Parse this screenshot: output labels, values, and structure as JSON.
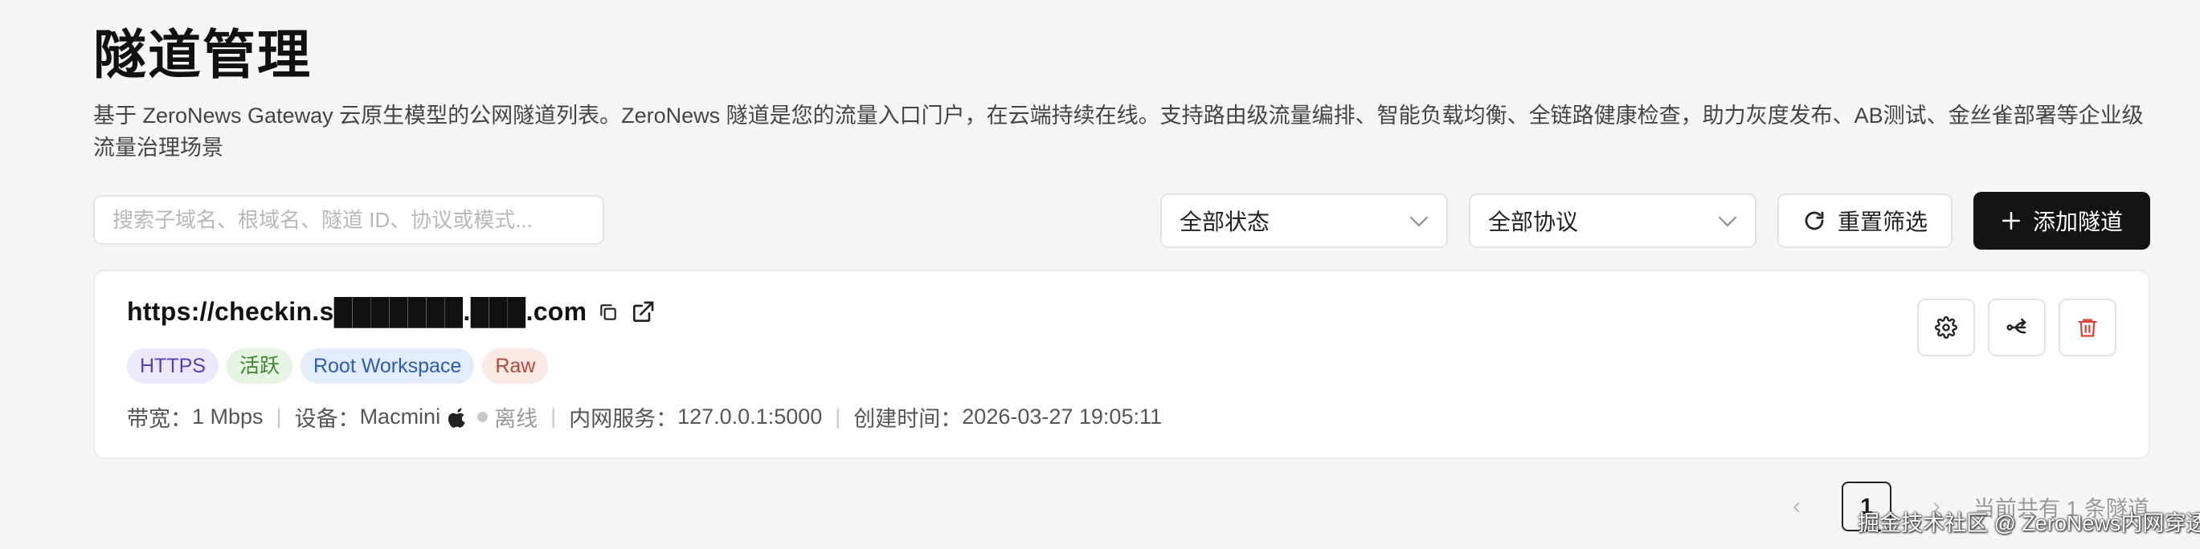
{
  "header": {
    "title": "隧道管理",
    "description": "基于 ZeroNews Gateway 云原生模型的公网隧道列表。ZeroNews 隧道是您的流量入口门户，在云端持续在线。支持路由级流量编排、智能负载均衡、全链路健康检查，助力灰度发布、AB测试、金丝雀部署等企业级流量治理场景"
  },
  "filters": {
    "search_placeholder": "搜索子域名、根域名、隧道 ID、协议或模式...",
    "status_select": "全部状态",
    "protocol_select": "全部协议",
    "reset_label": "重置筛选",
    "add_label": "添加隧道"
  },
  "tunnels": [
    {
      "url": "https://checkin.s███████.███.com",
      "tags": {
        "protocol": "HTTPS",
        "state": "活跃",
        "workspace": "Root Workspace",
        "mode": "Raw"
      },
      "bandwidth_label": "带宽：",
      "bandwidth_value": "1 Mbps",
      "device_label": "设备：",
      "device_value": "Macmini",
      "device_status": "离线",
      "service_label": "内网服务：",
      "service_value": "127.0.0.1:5000",
      "created_label": "创建时间：",
      "created_value": "2026-03-27 19:05:11"
    }
  ],
  "pagination": {
    "current_page": "1",
    "total_text": "当前共有 1 条隧道"
  },
  "watermark": "掘金技术社区 @ ZeroNews内网穿透",
  "colors": {
    "primary_button": "#141414",
    "delete_icon": "#d9453a",
    "tag_https": "#5b3db3",
    "tag_active": "#3a8a2c",
    "tag_workspace": "#2d5bb8",
    "tag_raw": "#b6473a"
  },
  "icons": [
    "refresh-icon",
    "plus-icon",
    "copy-icon",
    "external-link-icon",
    "apple-icon",
    "settings-icon",
    "route-icon",
    "trash-icon",
    "chevron-down-icon"
  ]
}
